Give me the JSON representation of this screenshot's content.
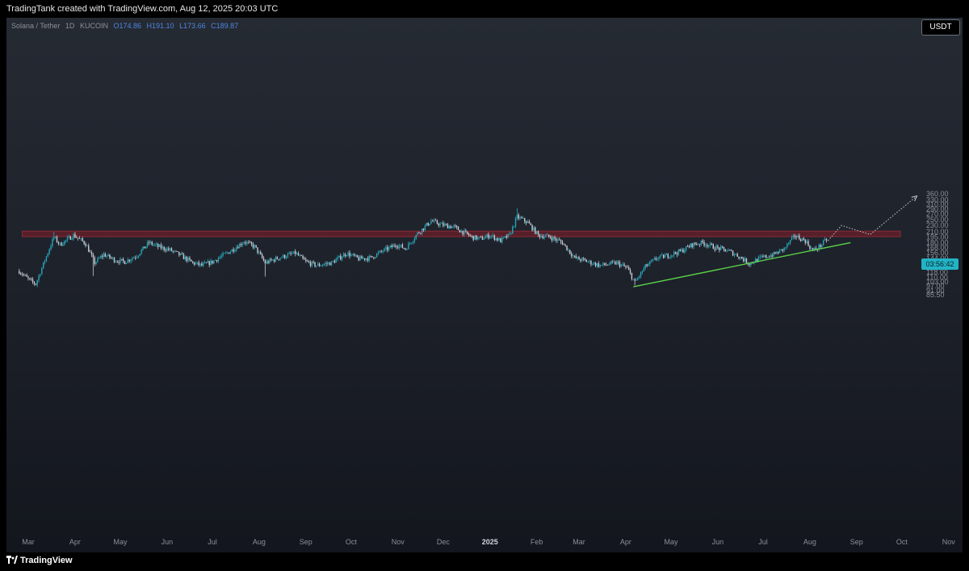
{
  "header": {
    "attribution": "TradingTank created with TradingView.com, Aug 12, 2025 20:03 UTC"
  },
  "legend": {
    "symbol": "Solana / Tether",
    "interval": "1D",
    "exchange": "KUCOIN",
    "open": "O174.86",
    "high": "H191.10",
    "low": "L173.66",
    "close": "C189.87"
  },
  "currency_button": "USDT",
  "current_price_tag": "03:56:42",
  "footer": {
    "brand": "TradingView"
  },
  "colors": {
    "up": "#26a6b8",
    "down": "#c9ccd3",
    "resistance_zone": "#6b1f2a",
    "support_line": "#5ad14a",
    "projection": "#c9ccd3",
    "price_tag": "#22b4c6"
  },
  "chart_data": {
    "type": "candlestick",
    "symbol": "Solana / Tether",
    "yscale": "log",
    "y_ticks": [
      "360.00",
      "330.00",
      "310.00",
      "290.00",
      "270.00",
      "250.00",
      "230.00",
      "210.00",
      "195.00",
      "180.00",
      "168.00",
      "156.00",
      "144.00",
      "134.00",
      "126.00",
      "118.00",
      "110.00",
      "103.00",
      "97.00",
      "91.00",
      "85.50"
    ],
    "x_ticks": [
      "Mar",
      "Apr",
      "May",
      "Jun",
      "Jul",
      "Aug",
      "Sep",
      "Oct",
      "Nov",
      "Dec",
      "2025",
      "Feb",
      "Mar",
      "Apr",
      "May",
      "Jun",
      "Jul",
      "Aug",
      "Sep",
      "Oct",
      "Nov"
    ],
    "price_path": [
      [
        "2024-02-24",
        120
      ],
      [
        "2024-03-02",
        105
      ],
      [
        "2024-03-06",
        100
      ],
      [
        "2024-03-12",
        140
      ],
      [
        "2024-03-18",
        195
      ],
      [
        "2024-03-22",
        175
      ],
      [
        "2024-03-31",
        200
      ],
      [
        "2024-04-08",
        178
      ],
      [
        "2024-04-14",
        135
      ],
      [
        "2024-04-20",
        152
      ],
      [
        "2024-04-28",
        140
      ],
      [
        "2024-05-04",
        137
      ],
      [
        "2024-05-12",
        150
      ],
      [
        "2024-05-20",
        180
      ],
      [
        "2024-05-26",
        170
      ],
      [
        "2024-06-03",
        162
      ],
      [
        "2024-06-10",
        150
      ],
      [
        "2024-06-18",
        135
      ],
      [
        "2024-06-24",
        130
      ],
      [
        "2024-07-01",
        137
      ],
      [
        "2024-07-08",
        150
      ],
      [
        "2024-07-14",
        162
      ],
      [
        "2024-07-22",
        183
      ],
      [
        "2024-07-29",
        170
      ],
      [
        "2024-08-05",
        135
      ],
      [
        "2024-08-14",
        145
      ],
      [
        "2024-08-25",
        155
      ],
      [
        "2024-09-01",
        137
      ],
      [
        "2024-09-08",
        130
      ],
      [
        "2024-09-18",
        135
      ],
      [
        "2024-09-28",
        155
      ],
      [
        "2024-10-06",
        143
      ],
      [
        "2024-10-14",
        145
      ],
      [
        "2024-10-22",
        160
      ],
      [
        "2024-10-31",
        175
      ],
      [
        "2024-11-06",
        165
      ],
      [
        "2024-11-14",
        205
      ],
      [
        "2024-11-23",
        245
      ],
      [
        "2024-11-30",
        232
      ],
      [
        "2024-12-08",
        225
      ],
      [
        "2024-12-20",
        195
      ],
      [
        "2024-12-26",
        190
      ],
      [
        "2025-01-01",
        200
      ],
      [
        "2025-01-08",
        185
      ],
      [
        "2025-01-14",
        200
      ],
      [
        "2025-01-19",
        260
      ],
      [
        "2025-01-26",
        240
      ],
      [
        "2025-02-02",
        200
      ],
      [
        "2025-02-10",
        195
      ],
      [
        "2025-02-18",
        180
      ],
      [
        "2025-02-26",
        145
      ],
      [
        "2025-03-04",
        140
      ],
      [
        "2025-03-15",
        130
      ],
      [
        "2025-03-26",
        135
      ],
      [
        "2025-04-02",
        125
      ],
      [
        "2025-04-07",
        102
      ],
      [
        "2025-04-14",
        128
      ],
      [
        "2025-04-22",
        145
      ],
      [
        "2025-04-29",
        150
      ],
      [
        "2025-05-08",
        160
      ],
      [
        "2025-05-15",
        175
      ],
      [
        "2025-05-22",
        180
      ],
      [
        "2025-05-30",
        168
      ],
      [
        "2025-06-08",
        160
      ],
      [
        "2025-06-14",
        150
      ],
      [
        "2025-06-22",
        134
      ],
      [
        "2025-06-30",
        145
      ],
      [
        "2025-07-08",
        152
      ],
      [
        "2025-07-15",
        165
      ],
      [
        "2025-07-22",
        198
      ],
      [
        "2025-07-29",
        185
      ],
      [
        "2025-08-03",
        160
      ],
      [
        "2025-08-08",
        172
      ],
      [
        "2025-08-12",
        188
      ]
    ],
    "spike_lows": [
      [
        "2024-04-13",
        112
      ],
      [
        "2024-08-05",
        111
      ],
      [
        "2025-04-07",
        98
      ],
      [
        "2025-06-22",
        127
      ]
    ],
    "spike_highs": [
      [
        "2025-01-19",
        294
      ],
      [
        "2024-03-18",
        210
      ],
      [
        "2025-07-22",
        204
      ]
    ],
    "resistance_zone": {
      "low": 196,
      "high": 212,
      "from": "2024-02-26",
      "to": "2025-09-30"
    },
    "support_line": [
      [
        "2025-04-06",
        96
      ],
      [
        "2025-08-28",
        180
      ]
    ],
    "projection_path": [
      [
        "2025-08-13",
        185
      ],
      [
        "2025-08-22",
        230
      ],
      [
        "2025-09-10",
        202
      ],
      [
        "2025-10-11",
        350
      ]
    ]
  }
}
